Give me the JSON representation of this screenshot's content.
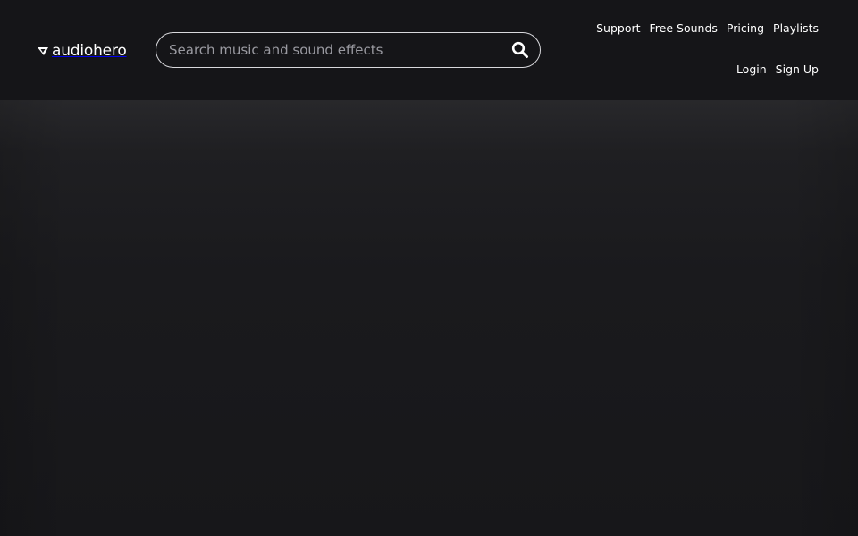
{
  "brand": {
    "name": "audiohero",
    "logo_icon": "audiohero-logo-mark"
  },
  "search": {
    "placeholder": "Search music and sound effects",
    "value": "",
    "button_icon": "search-icon"
  },
  "nav": {
    "primary": [
      {
        "label": "Support"
      },
      {
        "label": "Free Sounds"
      },
      {
        "label": "Pricing"
      },
      {
        "label": "Playlists"
      }
    ],
    "account": [
      {
        "label": "Login"
      },
      {
        "label": "Sign Up"
      }
    ]
  },
  "colors": {
    "background": "#151518",
    "text": "#ffffff",
    "placeholder": "#9a9aa1",
    "search_border": "#d8d8dc"
  }
}
